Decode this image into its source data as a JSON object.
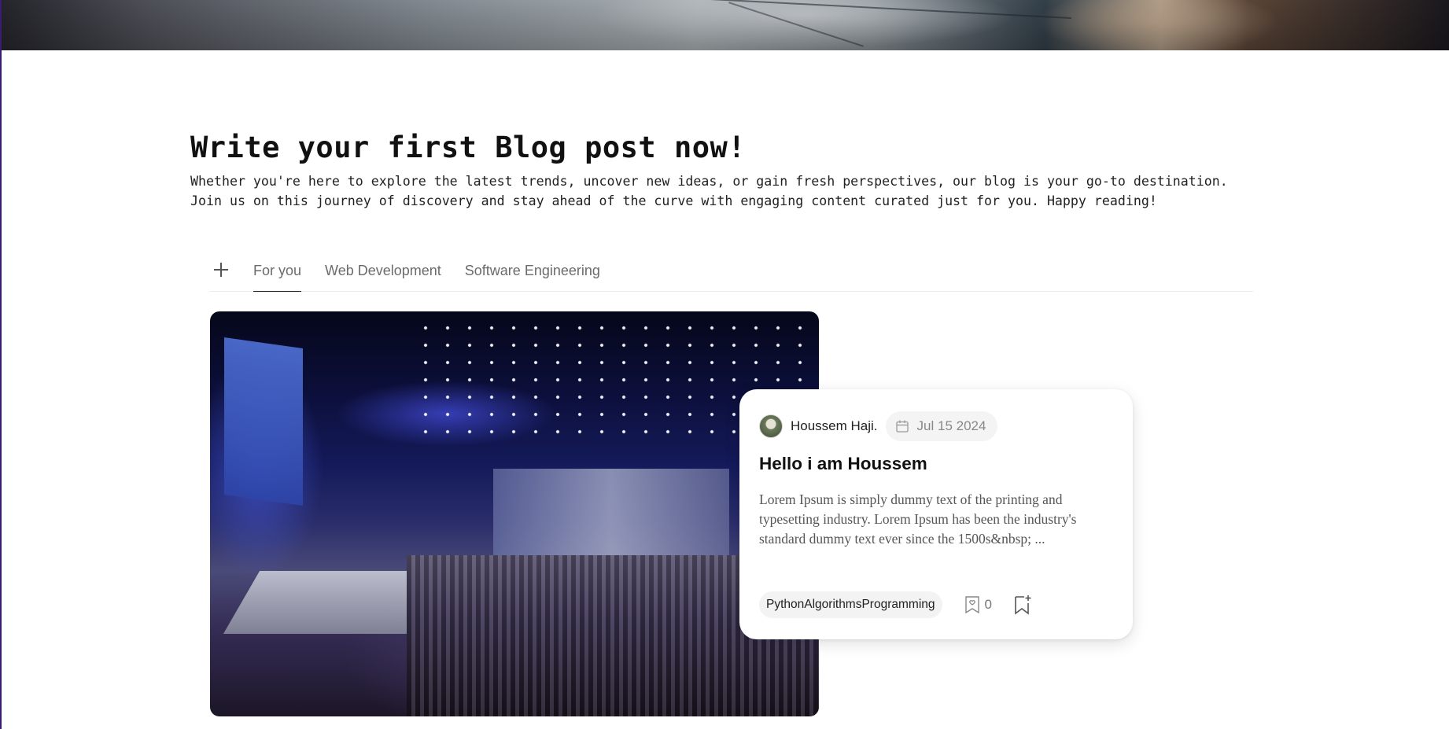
{
  "intro": {
    "title": "Write your first Blog post now!",
    "description": "Whether you're here to explore the latest trends, uncover new ideas, or gain fresh perspectives, our blog is your go-to destination. Join us on this journey of discovery and stay ahead of the curve with engaging content curated just for you. Happy reading!"
  },
  "tabs": {
    "add_icon": "plus-icon",
    "items": [
      {
        "label": "For you",
        "active": true
      },
      {
        "label": "Web Development",
        "active": false
      },
      {
        "label": "Software Engineering",
        "active": false
      }
    ]
  },
  "post": {
    "author": "Houssem Haji.",
    "date": "Jul 15 2024",
    "title": "Hello i am Houssem",
    "excerpt": "Lorem Ipsum is simply dummy text of the printing and typesetting industry. Lorem Ipsum has been the industry's standard dummy text ever since the 1500s&nbsp; ...",
    "tag": "PythonAlgorithmsProgramming",
    "comment_count": "0",
    "icons": {
      "date": "calendar-icon",
      "comments": "comment-icon",
      "save": "bookmark-add-icon"
    }
  },
  "colors": {
    "accent_border": "#3a1d6e",
    "text_primary": "#111111",
    "text_muted": "#6b6b6b",
    "pill_bg": "#f4f4f4"
  }
}
